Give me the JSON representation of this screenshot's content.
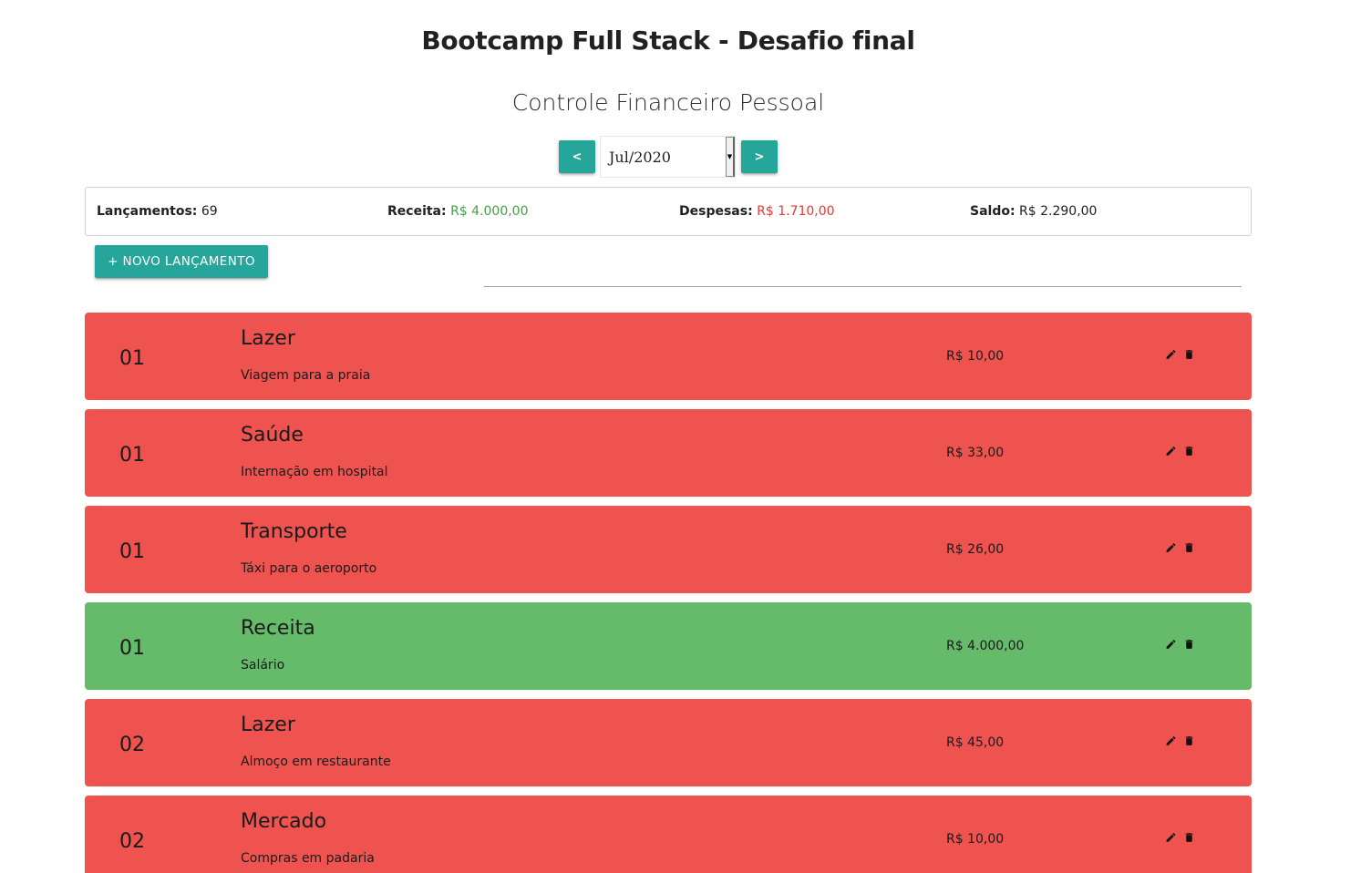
{
  "header": {
    "title": "Bootcamp Full Stack - Desafio final",
    "subtitle": "Controle Financeiro Pessoal"
  },
  "period": {
    "prev_label": "<",
    "next_label": ">",
    "selected": "Jul/2020"
  },
  "summary": {
    "launches_label": "Lançamentos:",
    "launches_value": "69",
    "revenue_label": "Receita:",
    "revenue_value": "R$ 4.000,00",
    "expenses_label": "Despesas:",
    "expenses_value": "R$ 1.710,00",
    "balance_label": "Saldo:",
    "balance_value": "R$ 2.290,00"
  },
  "toolbar": {
    "new_label": "+ NOVO LANÇAMENTO",
    "filter_value": ""
  },
  "colors": {
    "accent": "#26a69a",
    "expense_row": "#ef5350",
    "revenue_row": "#66bb6a",
    "revenue_text": "#43a047",
    "expense_text": "#e53935"
  },
  "icons": {
    "edit": "pencil-icon",
    "delete": "trash-icon"
  },
  "transactions": [
    {
      "day": "01",
      "category": "Lazer",
      "description": "Viagem para a praia",
      "value": "R$ 10,00",
      "type": "expense"
    },
    {
      "day": "01",
      "category": "Saúde",
      "description": "Internação em hospital",
      "value": "R$ 33,00",
      "type": "expense"
    },
    {
      "day": "01",
      "category": "Transporte",
      "description": "Táxi para o aeroporto",
      "value": "R$ 26,00",
      "type": "expense"
    },
    {
      "day": "01",
      "category": "Receita",
      "description": "Salário",
      "value": "R$ 4.000,00",
      "type": "revenue"
    },
    {
      "day": "02",
      "category": "Lazer",
      "description": "Almoço em restaurante",
      "value": "R$ 45,00",
      "type": "expense"
    },
    {
      "day": "02",
      "category": "Mercado",
      "description": "Compras em padaria",
      "value": "R$ 10,00",
      "type": "expense"
    }
  ]
}
